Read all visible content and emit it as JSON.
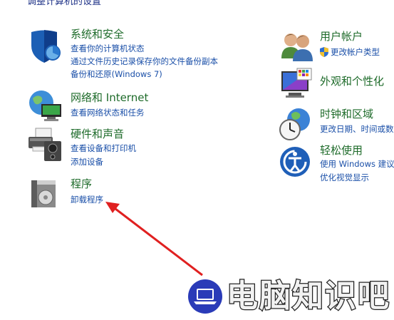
{
  "header": {
    "title": "调整计算机的设置"
  },
  "categories": {
    "system": {
      "title": "系统和安全",
      "links": [
        "查看你的计算机状态",
        "通过文件历史记录保存你的文件备份副本",
        "备份和还原(Windows 7)"
      ]
    },
    "network": {
      "title": "网络和 Internet",
      "links": [
        "查看网络状态和任务"
      ]
    },
    "hardware": {
      "title": "硬件和声音",
      "links": [
        "查看设备和打印机",
        "添加设备"
      ]
    },
    "programs": {
      "title": "程序",
      "links": [
        "卸载程序"
      ]
    },
    "user_accounts": {
      "title": "用户帐户",
      "links": [
        "更改帐户类型"
      ]
    },
    "appearance": {
      "title": "外观和个性化",
      "links": []
    },
    "clock_region": {
      "title": "时钟和区域",
      "links": [
        "更改日期、时间或数"
      ]
    },
    "ease_access": {
      "title": "轻松使用",
      "links": [
        "使用 Windows 建议",
        "优化视觉显示"
      ]
    }
  },
  "annotation": {
    "arrow_color": "#e02020"
  },
  "watermark": {
    "text": "电脑知识吧",
    "logo_color": "#2a3bb8"
  },
  "colors": {
    "category_title": "#1e6b2a",
    "link": "#1a4fa8"
  }
}
